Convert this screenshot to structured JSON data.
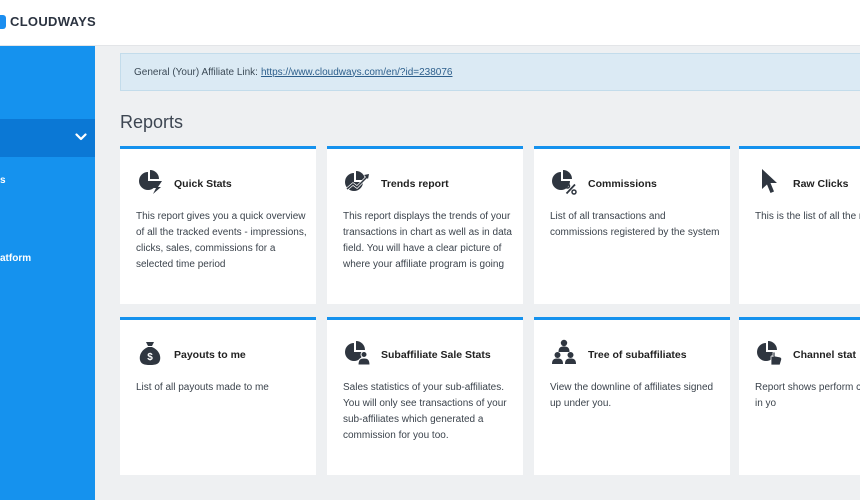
{
  "brand": {
    "name": "CLOUDWAYS"
  },
  "sidebar": {
    "items": [
      {
        "label": "s"
      },
      {
        "label": "atform"
      }
    ]
  },
  "notice": {
    "prefix": "General (Your) Affiliate Link:",
    "link": "https://www.cloudways.com/en/?id=238076"
  },
  "reports": {
    "title": "Reports",
    "cards": [
      {
        "title": "Quick Stats",
        "icon": "pie-chart-bolt-icon",
        "desc": "This report gives you a quick overview of all the tracked events - impressions, clicks, sales, commissions for a selected time period"
      },
      {
        "title": "Trends report",
        "icon": "trend-chart-icon",
        "desc": "This report displays the trends of your transactions in chart as well as in data field. You will have a clear picture of where your affiliate program is going"
      },
      {
        "title": "Commissions",
        "icon": "pie-percent-icon",
        "desc": "List of all transactions and commissions registered by the system"
      },
      {
        "title": "Raw Clicks",
        "icon": "cursor-icon",
        "desc": "This is the list of all the referred by you"
      },
      {
        "title": "Payouts to me",
        "icon": "money-bag-icon",
        "desc": "List of all payouts made to me"
      },
      {
        "title": "Subaffiliate Sale Stats",
        "icon": "pie-person-icon",
        "desc": "Sales statistics of your sub-affiliates. You will only see transactions of your sub-affiliates which generated a commission for you too."
      },
      {
        "title": "Tree of subaffiliates",
        "icon": "people-tree-icon",
        "desc": "View the downline of affiliates signed up under you."
      },
      {
        "title": "Channel stat",
        "icon": "pie-hand-icon",
        "desc": "Report shows perform channels defined in yo"
      }
    ]
  },
  "colors": {
    "accent": "#1592ee",
    "sidebar_active": "#0b78d5",
    "notice_bg": "#dbeaf4"
  }
}
